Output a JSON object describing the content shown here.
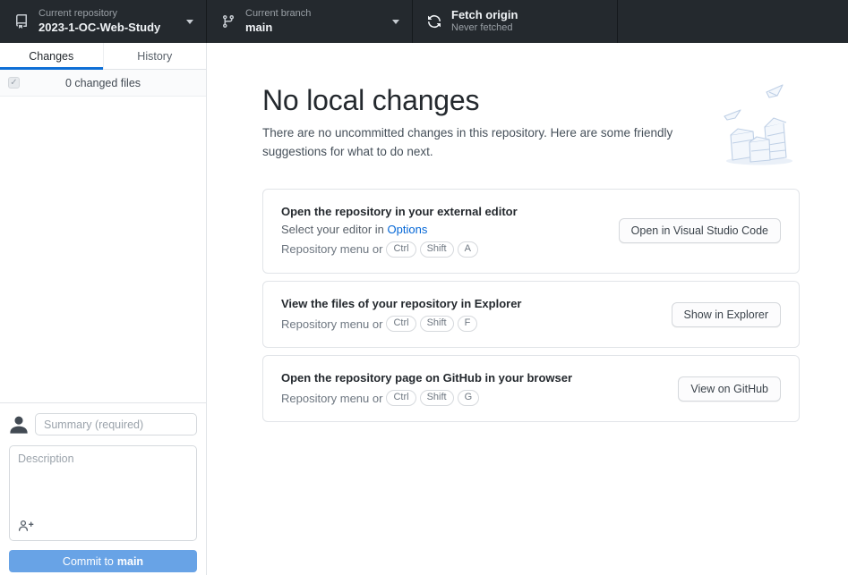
{
  "colors": {
    "toolbar-bg": "#24292e",
    "toolbar-divider": "#15191c",
    "accent": "#0f6fd6",
    "link": "#0366d6",
    "border": "#e1e4e8",
    "commit-btn": "#68a3e6"
  },
  "toolbar": {
    "repository": {
      "label": "Current repository",
      "value": "2023-1-OC-Web-Study"
    },
    "branch": {
      "label": "Current branch",
      "value": "main"
    },
    "fetch": {
      "title": "Fetch origin",
      "subtitle": "Never fetched"
    }
  },
  "sidebar": {
    "tabs": [
      {
        "label": "Changes"
      },
      {
        "label": "History"
      }
    ],
    "changed_files": "0 changed files",
    "commit": {
      "summary_placeholder": "Summary (required)",
      "description_placeholder": "Description",
      "button_prefix": "Commit to",
      "button_branch": "main"
    }
  },
  "main": {
    "title": "No local changes",
    "subtitle": "There are no uncommitted changes in this repository. Here are some friendly suggestions for what to do next.",
    "cards": [
      {
        "title": "Open the repository in your external editor",
        "subtitle_prefix": "Select your editor in ",
        "subtitle_link": "Options",
        "shortcut_prefix": "Repository menu or",
        "keys": [
          "Ctrl",
          "Shift",
          "A"
        ],
        "button": "Open in Visual Studio Code"
      },
      {
        "title": "View the files of your repository in Explorer",
        "shortcut_prefix": "Repository menu or",
        "keys": [
          "Ctrl",
          "Shift",
          "F"
        ],
        "button": "Show in Explorer"
      },
      {
        "title": "Open the repository page on GitHub in your browser",
        "shortcut_prefix": "Repository menu or",
        "keys": [
          "Ctrl",
          "Shift",
          "G"
        ],
        "button": "View on GitHub"
      }
    ]
  }
}
